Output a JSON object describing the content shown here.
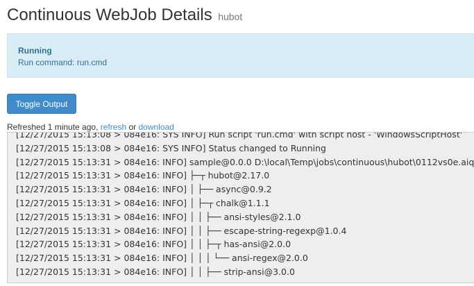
{
  "header": {
    "title": "Continuous WebJob Details",
    "subtitle": "hubot"
  },
  "status": {
    "state": "Running",
    "command": "Run command: run.cmd"
  },
  "toolbar": {
    "toggle_label": "Toggle Output"
  },
  "refresh": {
    "prefix": "Refreshed 1 minute ago,",
    "refresh_link": "refresh",
    "or_text": "or",
    "download_link": "download"
  },
  "log": {
    "lines": [
      "[12/27/2015 15:13:08 > 084e16: SYS INFO] Run script 'run.cmd' with script host - 'WindowsScriptHost'",
      "[12/27/2015 15:13:08 > 084e16: SYS INFO] Status changed to Running",
      "[12/27/2015 15:13:31 > 084e16: INFO] sample@0.0.0 D:\\local\\Temp\\jobs\\continuous\\hubot\\0112vs0e.aiq",
      "[12/27/2015 15:13:31 > 084e16: INFO] ├─┬ hubot@2.17.0",
      "[12/27/2015 15:13:31 > 084e16: INFO] │ ├── async@0.9.2",
      "[12/27/2015 15:13:31 > 084e16: INFO] │ ├─┬ chalk@1.1.1",
      "[12/27/2015 15:13:31 > 084e16: INFO] │ │ ├── ansi-styles@2.1.0",
      "[12/27/2015 15:13:31 > 084e16: INFO] │ │ ├── escape-string-regexp@1.0.4",
      "[12/27/2015 15:13:31 > 084e16: INFO] │ │ ├─┬ has-ansi@2.0.0",
      "[12/27/2015 15:13:31 > 084e16: INFO] │ │ │ └── ansi-regex@2.0.0",
      "[12/27/2015 15:13:31 > 084e16: INFO] │ │ ├── strip-ansi@3.0.0"
    ]
  }
}
